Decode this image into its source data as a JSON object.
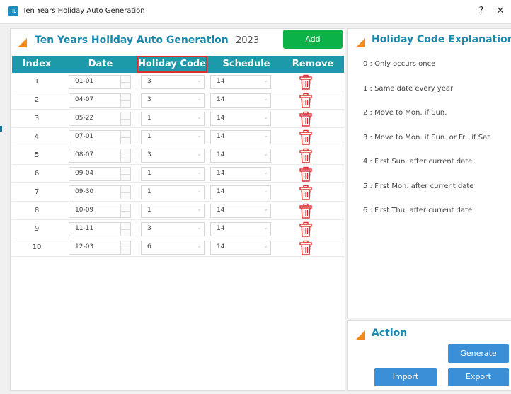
{
  "window": {
    "title": "Ten Years Holiday Auto Generation",
    "help_label": "?",
    "close_label": "✕",
    "icon_text": "HL"
  },
  "left_panel": {
    "title": "Ten Years Holiday Auto Generation",
    "year": "2023",
    "add_label": "Add"
  },
  "table": {
    "headers": {
      "index": "Index",
      "date": "Date",
      "holiday_code": "Holiday Code",
      "schedule": "Schedule",
      "remove": "Remove"
    },
    "rows": [
      {
        "index": "1",
        "date": "01-01",
        "code": "3",
        "schedule": "14"
      },
      {
        "index": "2",
        "date": "04-07",
        "code": "3",
        "schedule": "14"
      },
      {
        "index": "3",
        "date": "05-22",
        "code": "1",
        "schedule": "14"
      },
      {
        "index": "4",
        "date": "07-01",
        "code": "1",
        "schedule": "14"
      },
      {
        "index": "5",
        "date": "08-07",
        "code": "3",
        "schedule": "14"
      },
      {
        "index": "6",
        "date": "09-04",
        "code": "1",
        "schedule": "14"
      },
      {
        "index": "7",
        "date": "09-30",
        "code": "1",
        "schedule": "14"
      },
      {
        "index": "8",
        "date": "10-09",
        "code": "1",
        "schedule": "14"
      },
      {
        "index": "9",
        "date": "11-11",
        "code": "3",
        "schedule": "14"
      },
      {
        "index": "10",
        "date": "12-03",
        "code": "6",
        "schedule": "14"
      }
    ]
  },
  "explanation": {
    "title": "Holiday Code Explanation",
    "items": [
      "0 : Only occurs once",
      "1 : Same date every year",
      "2 : Move to Mon. if Sun.",
      "3 : Move to Mon. if Sun. or Fri. if Sat.",
      "4 : First Sun. after current date",
      "5 : First Mon. after current date",
      "6 : First Thu. after current date"
    ]
  },
  "action": {
    "title": "Action",
    "generate_label": "Generate",
    "import_label": "Import",
    "export_label": "Export"
  },
  "colors": {
    "accent_teal": "#1c9aaa",
    "title_blue": "#1888ad",
    "add_green": "#0bb247",
    "action_blue": "#3a8fd6",
    "trash_red": "#d9302f",
    "triangle_orange": "#f28a1a"
  },
  "icons": {
    "remove": "trash-icon",
    "dropdown": "chevron-down-icon",
    "spinner": "spinner-arrows-icon",
    "section": "orange-triangle-icon"
  }
}
